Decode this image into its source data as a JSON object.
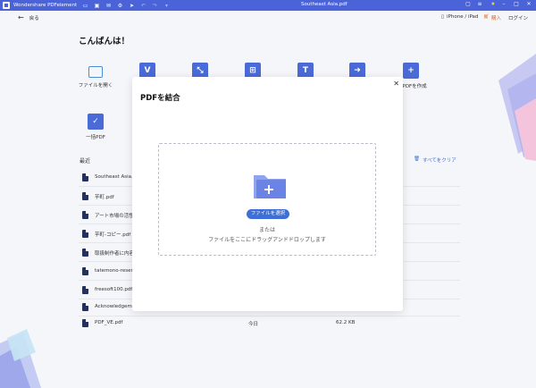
{
  "titlebar": {
    "app_name": "Wondershare PDFelement",
    "doc_title": "Southeast Asia.pdf",
    "icons": [
      "folder-icon",
      "save-icon",
      "mail-icon",
      "settings-icon",
      "send-icon",
      "undo-icon",
      "redo-icon",
      "dropdown-icon"
    ]
  },
  "nav": {
    "back_label": "戻る",
    "device_label": "iPhone / iPad",
    "buy_label": "購入",
    "login_label": "ログイン"
  },
  "greeting": "こんばんは！",
  "tools": [
    {
      "label": "ファイルを開く",
      "icon": "open-folder-icon"
    },
    {
      "label": "",
      "icon": "pdf-convert-icon"
    },
    {
      "label": "",
      "icon": "compress-icon"
    },
    {
      "label": "",
      "icon": "combine-icon"
    },
    {
      "label": "",
      "icon": "ocr-icon"
    },
    {
      "label": "",
      "icon": "export-icon"
    },
    {
      "label": "PDFを作成",
      "icon": "create-pdf-icon"
    },
    {
      "label": "一括PDF",
      "icon": "batch-pdf-icon"
    }
  ],
  "recent": {
    "title": "最近",
    "clear_all": "すべてをクリア",
    "files": [
      {
        "name": "Southeast Asia.pdf",
        "date": "",
        "size": ""
      },
      {
        "name": "芋町.pdf",
        "date": "",
        "size": ""
      },
      {
        "name": "アート市場の活性",
        "date": "",
        "size": ""
      },
      {
        "name": "芋町-コピー.pdf",
        "date": "",
        "size": ""
      },
      {
        "name": "取扱制作者に内容",
        "date": "",
        "size": ""
      },
      {
        "name": "tatemono-reserv",
        "date": "",
        "size": ""
      },
      {
        "name": "freesoft100.pdf",
        "date": "",
        "size": ""
      },
      {
        "name": "Acknowledgemen",
        "date": "",
        "size": ""
      },
      {
        "name": "PDF_VE.pdf",
        "date": "今日",
        "size": "62.2 KB"
      }
    ]
  },
  "modal": {
    "title": "PDFを結合",
    "select_button": "ファイルを選択",
    "or_text": "または",
    "drop_hint": "ファイルをここにドラッグアンドドロップします"
  },
  "colors": {
    "titlebar": "#4b63d8",
    "accent": "#3d6fd6",
    "buy": "#e46b2a"
  }
}
